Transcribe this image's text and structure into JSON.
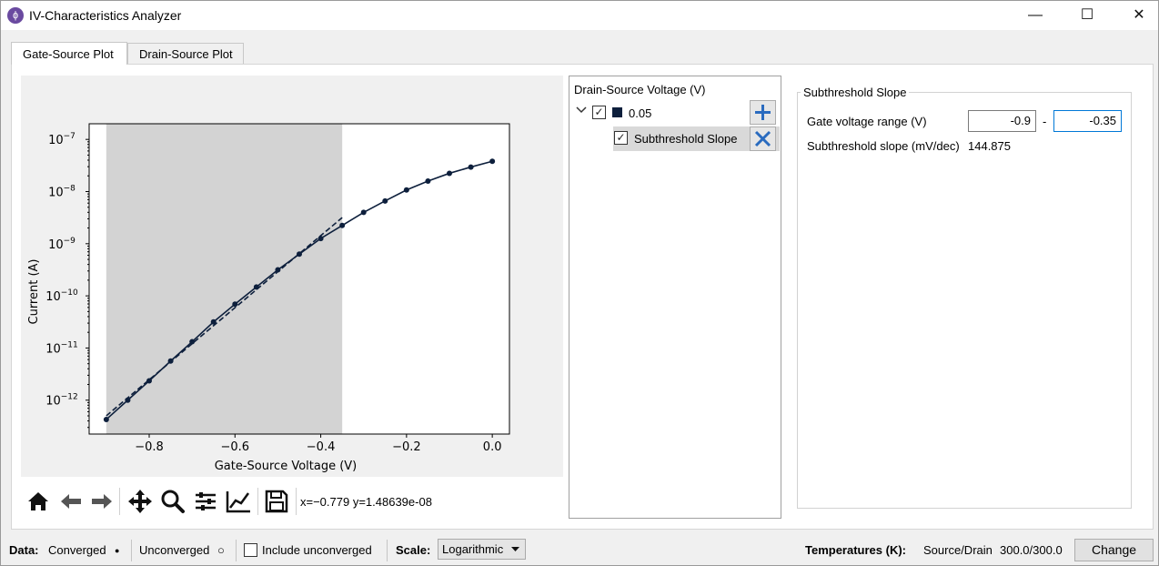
{
  "window": {
    "title": "IV-Characteristics Analyzer",
    "icon": "app-logo-icon",
    "controls": {
      "minimize": "—",
      "maximize": "☐",
      "close": "✕"
    }
  },
  "tabs": [
    {
      "label": "Gate-Source Plot",
      "active": true
    },
    {
      "label": "Drain-Source Plot",
      "active": false
    }
  ],
  "plot": {
    "toolbar": {
      "icons": [
        "home-icon",
        "back-arrow-icon",
        "forward-arrow-icon",
        "pan-icon",
        "zoom-icon",
        "configure-subplots-icon",
        "edit-axis-icon",
        "save-icon"
      ],
      "coords": "x=−0.779 y=1.48639e-08"
    }
  },
  "chart_data": {
    "type": "line",
    "xlabel": "Gate-Source Voltage (V)",
    "ylabel": "Current (A)",
    "xlim": [
      -0.94,
      0.04
    ],
    "ylim_log10": [
      -12.65,
      -6.7
    ],
    "yscale": "log",
    "x_ticks": [
      {
        "value": -0.8,
        "label": "−0.8"
      },
      {
        "value": -0.6,
        "label": "−0.6"
      },
      {
        "value": -0.4,
        "label": "−0.4"
      },
      {
        "value": -0.2,
        "label": "−0.2"
      },
      {
        "value": 0.0,
        "label": "0.0"
      }
    ],
    "y_ticks": [
      {
        "exp": -7,
        "base": "10",
        "sup": "−7"
      },
      {
        "exp": -8,
        "base": "10",
        "sup": "−8"
      },
      {
        "exp": -9,
        "base": "10",
        "sup": "−9"
      },
      {
        "exp": -10,
        "base": "10",
        "sup": "−10"
      },
      {
        "exp": -11,
        "base": "10",
        "sup": "−11"
      },
      {
        "exp": -12,
        "base": "10",
        "sup": "−12"
      }
    ],
    "shaded_range": [
      -0.9,
      -0.35
    ],
    "series": [
      {
        "name": "0.05",
        "color": "#0d1f3c",
        "x": [
          -0.9,
          -0.85,
          -0.8,
          -0.75,
          -0.7,
          -0.65,
          -0.6,
          -0.55,
          -0.5,
          -0.45,
          -0.4,
          -0.35,
          -0.3,
          -0.25,
          -0.2,
          -0.15,
          -0.1,
          -0.05,
          0.0
        ],
        "log10_y": [
          -12.37,
          -12.0,
          -11.63,
          -11.25,
          -10.88,
          -10.5,
          -10.16,
          -9.83,
          -9.5,
          -9.2,
          -8.9,
          -8.65,
          -8.4,
          -8.18,
          -7.97,
          -7.8,
          -7.65,
          -7.53,
          -7.42
        ]
      }
    ],
    "fit_line": {
      "style": "dashed",
      "x": [
        -0.9,
        -0.35
      ],
      "log10_y": [
        -12.3,
        -8.5
      ]
    }
  },
  "series_tree": {
    "header": "Drain-Source Voltage (V)",
    "items": [
      {
        "label": "0.05",
        "checked": true,
        "color": "#0d1f3c",
        "expand_icon": "⌄"
      },
      {
        "label": "Subthreshold Slope",
        "checked": true
      }
    ],
    "add_icon": "plus-icon",
    "remove_icon": "remove-x-icon"
  },
  "subthreshold": {
    "group_title": "Subthreshold Slope",
    "range_label": "Gate voltage range (V)",
    "range_from": "-0.9",
    "range_dash": "-",
    "range_to": "-0.35",
    "slope_label": "Subthreshold slope (mV/dec)",
    "slope_value": "144.875"
  },
  "status": {
    "data_label": "Data:",
    "converged": "Converged",
    "converged_marker": "●",
    "unconverged": "Unconverged",
    "unconverged_marker": "○",
    "include_unconverged": "Include unconverged",
    "include_unconverged_checked": false,
    "scale_label": "Scale:",
    "scale_value": "Logarithmic",
    "temps_label": "Temperatures (K):",
    "temps_source_drain": "Source/Drain",
    "temps_value": "300.0/300.0",
    "change_button": "Change"
  }
}
